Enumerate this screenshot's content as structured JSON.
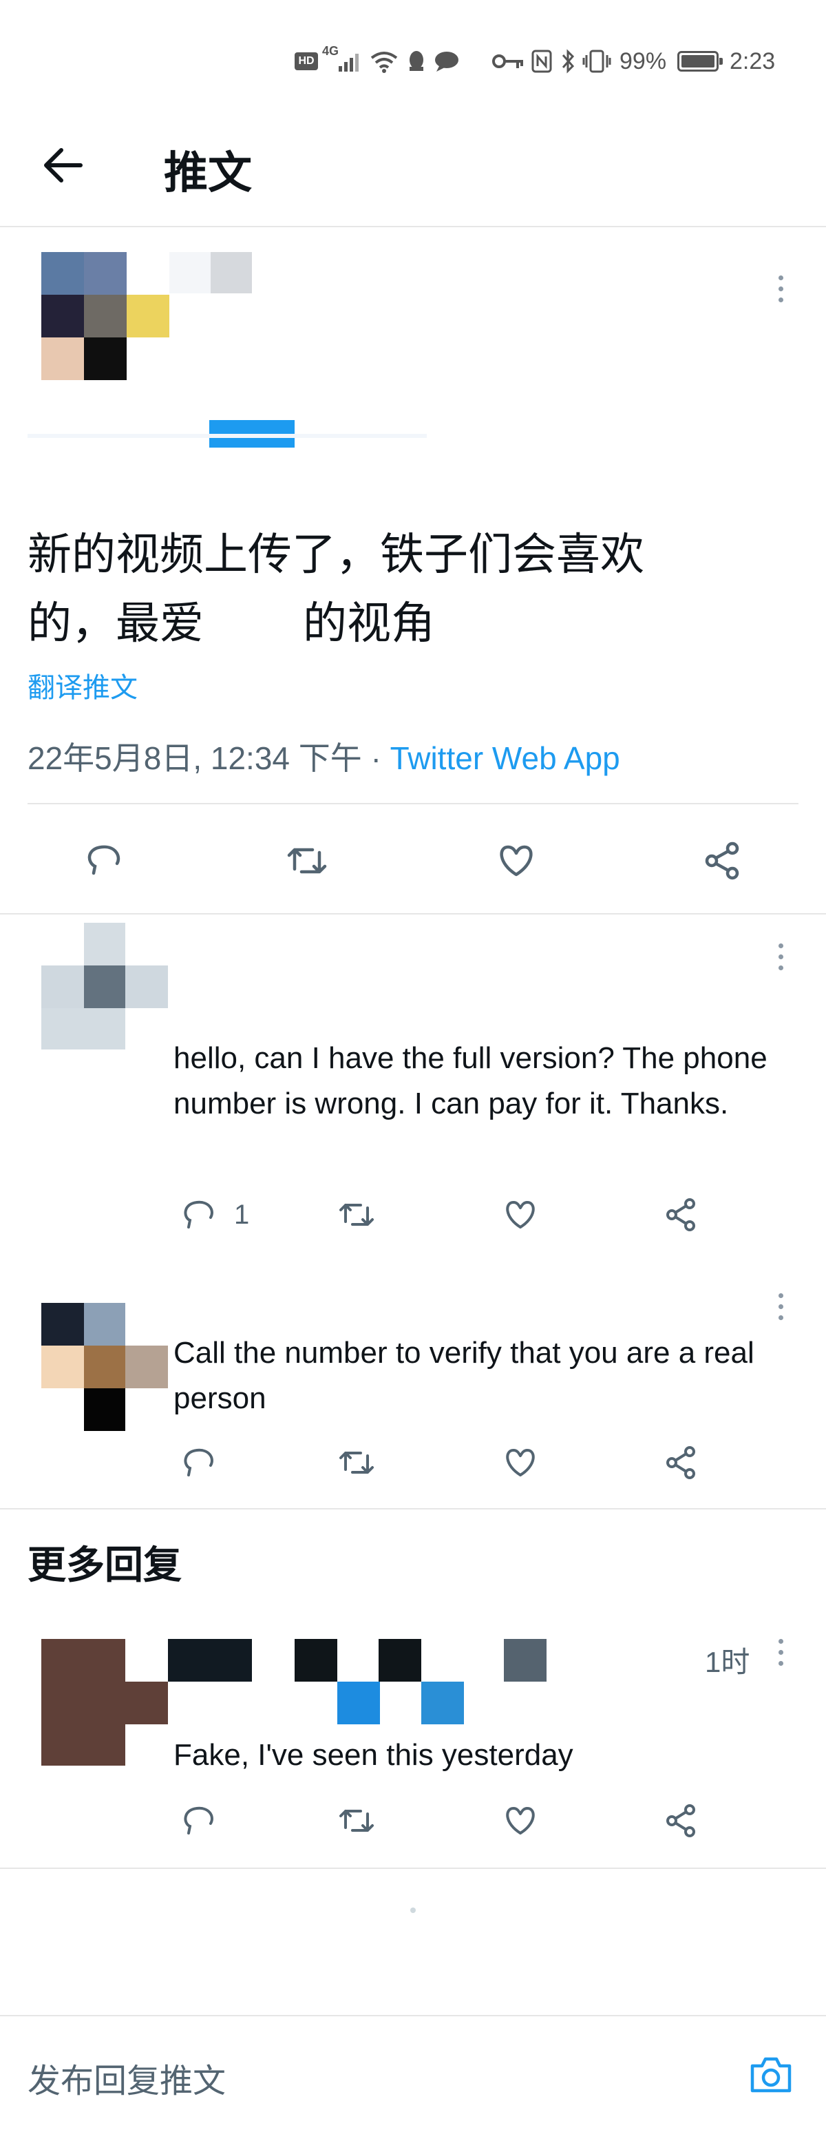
{
  "status_bar": {
    "network": "4G",
    "battery": "99%",
    "time": "2:23"
  },
  "header": {
    "title": "推文"
  },
  "main_tweet": {
    "text_line1": "新的视频上传了，铁子们会喜欢",
    "text_line2_a": "的，最爱",
    "text_line2_b": "的视角",
    "translate_label": "翻译推文",
    "timestamp": "22年5月8日, 12:34 下午 · ",
    "source": "Twitter Web App"
  },
  "replies": [
    {
      "text": "hello, can I have the full version? The phone number is wrong. I can pay for it. Thanks.",
      "reply_count": "1"
    },
    {
      "text": "Call the number to verify that you are a real person"
    }
  ],
  "more_replies": {
    "title": "更多回复",
    "items": [
      {
        "time": "1时",
        "text": "Fake, I've seen this yesterday"
      }
    ]
  },
  "composer": {
    "placeholder": "发布回复推文"
  },
  "colors": {
    "accent": "#1d9bf0",
    "secondary_text": "#536471",
    "divider": "#e6e6e6"
  },
  "icons": [
    "back-arrow-icon",
    "reply-icon",
    "retweet-icon",
    "like-icon",
    "share-icon",
    "more-icon",
    "camera-icon"
  ]
}
